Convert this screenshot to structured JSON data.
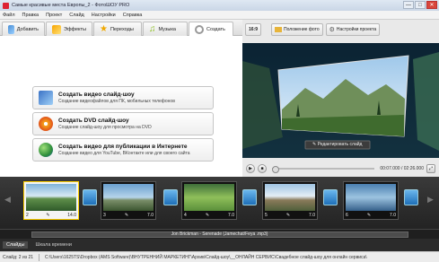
{
  "window": {
    "title": "Самые красивые места Европы_2 - ФотоШОУ PRO",
    "minimize": "—",
    "maximize": "□",
    "close": "✕"
  },
  "menu": [
    "Файл",
    "Правка",
    "Проект",
    "Слайд",
    "Настройки",
    "Справка"
  ],
  "tabs": [
    {
      "label": "Добавить",
      "icon": "add-photos-icon"
    },
    {
      "label": "Эффекты",
      "icon": "effects-icon"
    },
    {
      "label": "Переходы",
      "icon": "star-transitions-icon"
    },
    {
      "label": "Музыка",
      "icon": "music-note-icon"
    },
    {
      "label": "Создать",
      "icon": "disc-create-icon",
      "active": true
    }
  ],
  "create_options": [
    {
      "title": "Создать видео слайд-шоу",
      "subtitle": "Создание видеофайлов для ПК, мобильных телефонов",
      "icon": "video-file-icon"
    },
    {
      "title": "Создать DVD слайд-шоу",
      "subtitle": "Создание слайд-шоу для просмотра на DVD",
      "icon": "dvd-disc-icon"
    },
    {
      "title": "Создать видео для публикации в Интернете",
      "subtitle": "Создание видео для YouTube, ВКонтакте или для своего сайта",
      "icon": "globe-icon"
    }
  ],
  "preview": {
    "aspect": "16:9",
    "photo_position": "Положение фото",
    "project_settings": "Настройки проекта",
    "edit_slide": "Редактировать слайд",
    "time": "00:07.000 / 02:26.000"
  },
  "colors": {
    "accent": "#ffd200",
    "timeline_bg": "#2b2b2b"
  },
  "timeline": {
    "slides": [
      {
        "num": "2",
        "duration": "14.0",
        "selected": true
      },
      {
        "num": "3",
        "duration": "7.0"
      },
      {
        "num": "4",
        "duration": "7.0"
      },
      {
        "num": "5",
        "duration": "7.0"
      },
      {
        "num": "6",
        "duration": "7.0"
      }
    ],
    "music": "Jon Brickman - Serenade (Jamechat/Feya .mp3)"
  },
  "bottom_tabs": [
    "Слайды",
    "Шкала времени"
  ],
  "status": {
    "slide": "Слайд: 2 из 21",
    "path": "C:\\Users\\1625TS\\Dropbox (AMS Software)\\ВНУТРЕННИЙ МАРКЕТИНГ\\Архив\\Слайд-шоу\\__ОНЛАЙН СЕРВИС\\Свадебное слайд-шоу для онлайн сервиса\\"
  }
}
